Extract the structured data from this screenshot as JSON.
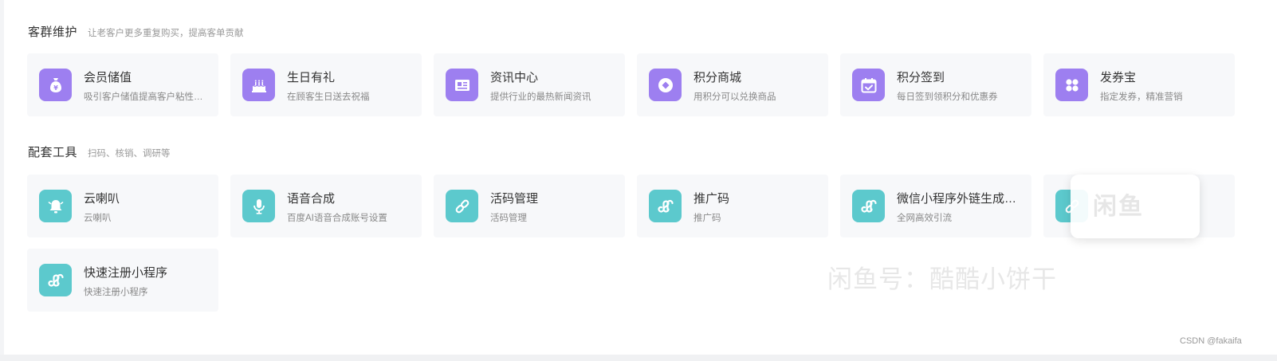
{
  "sections": [
    {
      "title": "客群维护",
      "subtitle": "让老客户更多重复购买，提高客单贡献",
      "cards": [
        {
          "title": "会员储值",
          "desc": "吸引客户储值提高客户粘性…",
          "icon": "money-bag-icon",
          "color": "purple"
        },
        {
          "title": "生日有礼",
          "desc": "在顾客生日送去祝福",
          "icon": "birthday-cake-icon",
          "color": "purple"
        },
        {
          "title": "资讯中心",
          "desc": "提供行业的最热新闻资讯",
          "icon": "news-icon",
          "color": "purple"
        },
        {
          "title": "积分商城",
          "desc": "用积分可以兑换商品",
          "icon": "points-coin-icon",
          "color": "purple"
        },
        {
          "title": "积分签到",
          "desc": "每日签到领积分和优惠券",
          "icon": "calendar-check-icon",
          "color": "purple"
        },
        {
          "title": "发券宝",
          "desc": "指定发券，精准营销",
          "icon": "grid-petals-icon",
          "color": "purple"
        }
      ]
    },
    {
      "title": "配套工具",
      "subtitle": "扫码、核销、调研等",
      "cards": [
        {
          "title": "云喇叭",
          "desc": "云喇叭",
          "icon": "bell-icon",
          "color": "teal"
        },
        {
          "title": "语音合成",
          "desc": "百度AI语音合成账号设置",
          "icon": "microphone-icon",
          "color": "teal"
        },
        {
          "title": "活码管理",
          "desc": "活码管理",
          "icon": "link-icon",
          "color": "teal"
        },
        {
          "title": "推广码",
          "desc": "推广码",
          "icon": "miniprogram-icon",
          "color": "teal"
        },
        {
          "title": "微信小程序外链生成…",
          "desc": "全网高效引流",
          "icon": "miniprogram-icon",
          "color": "teal"
        },
        {
          "title": "",
          "desc": "",
          "icon": "link-icon",
          "color": "teal"
        },
        {
          "title": "快速注册小程序",
          "desc": "快速注册小程序",
          "icon": "miniprogram-icon",
          "color": "teal"
        }
      ]
    }
  ],
  "overlay": {
    "popup_text": "闲鱼",
    "watermark_text": "闲鱼号：酷酷小饼干",
    "credit": "CSDN @fakaifa"
  },
  "colors": {
    "purple": "#9d7ff0",
    "teal": "#5cc9cd",
    "card_bg": "#f7f8fa"
  }
}
